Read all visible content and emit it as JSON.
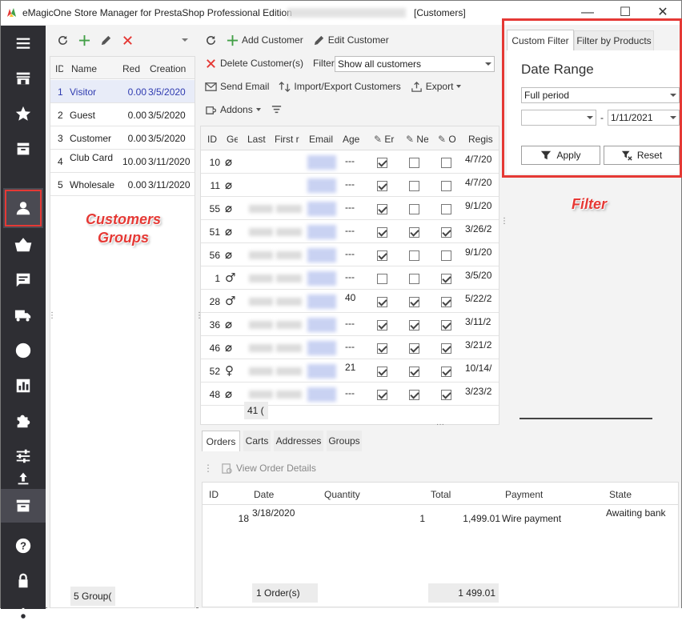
{
  "window": {
    "title": "eMagicOne Store Manager for PrestaShop Professional Edition",
    "document": "[Customers]",
    "controls": [
      "—",
      "☐",
      "✕"
    ]
  },
  "sidebar": {
    "icons": [
      "menu-icon",
      "store-icon",
      "star-icon",
      "catalog-box-icon",
      "customer-icon",
      "basket-icon",
      "message-icon",
      "truck-icon",
      "globe-icon",
      "report-icon",
      "puzzle-icon",
      "sliders-icon",
      "upload-icon",
      "archive-icon",
      "help-icon",
      "lock-icon",
      "settings-icon"
    ]
  },
  "groups": {
    "columns": [
      "ID",
      "Name",
      "Red",
      "Creation"
    ],
    "rows": [
      {
        "id": "1",
        "name": "Visitor",
        "red": "0.00",
        "date": "3/5/2020",
        "selected": true
      },
      {
        "id": "2",
        "name": "Guest",
        "red": "0.00",
        "date": "3/5/2020"
      },
      {
        "id": "3",
        "name": "Customer",
        "red": "0.00",
        "date": "3/5/2020"
      },
      {
        "id": "4",
        "name": "Club Card",
        "red": "10.00",
        "date": "3/11/2020"
      },
      {
        "id": "5",
        "name": "Wholesale",
        "red": "0.00",
        "date": "3/11/2020"
      }
    ],
    "footer": "5 Group("
  },
  "customers_toolbar": {
    "add": "Add Customer",
    "edit": "Edit Customer",
    "delete": "Delete Customer(s)",
    "filter_label": "Filter",
    "filter_value": "Show all customers",
    "send_email": "Send Email",
    "import_export": "Import/Export Customers",
    "export": "Export",
    "addons": "Addons"
  },
  "customers": {
    "columns": [
      "ID",
      "Ge",
      "Last",
      "First r",
      "Email",
      "Age",
      "Er",
      "Ne",
      "O",
      "Regis"
    ],
    "rows": [
      {
        "id": "10",
        "gender": "⌀",
        "age": "---",
        "c1": true,
        "c2": false,
        "c3": false,
        "reg": "4/7/20"
      },
      {
        "id": "11",
        "gender": "⌀",
        "age": "---",
        "c1": true,
        "c2": false,
        "c3": false,
        "reg": "4/7/20"
      },
      {
        "id": "55",
        "gender": "⌀",
        "age": "---",
        "c1": true,
        "c2": false,
        "c3": false,
        "reg": "9/1/20"
      },
      {
        "id": "51",
        "gender": "⌀",
        "age": "---",
        "c1": true,
        "c2": true,
        "c3": true,
        "reg": "3/26/2"
      },
      {
        "id": "56",
        "gender": "⌀",
        "age": "---",
        "c1": true,
        "c2": false,
        "c3": false,
        "reg": "9/1/20"
      },
      {
        "id": "1",
        "gender": "♂",
        "age": "---",
        "c1": false,
        "c2": false,
        "c3": true,
        "reg": "3/5/20"
      },
      {
        "id": "28",
        "gender": "♂",
        "age": "40",
        "c1": true,
        "c2": true,
        "c3": true,
        "reg": "5/22/2"
      },
      {
        "id": "36",
        "gender": "⌀",
        "age": "---",
        "c1": true,
        "c2": true,
        "c3": true,
        "reg": "3/11/2"
      },
      {
        "id": "46",
        "gender": "⌀",
        "age": "---",
        "c1": true,
        "c2": true,
        "c3": true,
        "reg": "3/21/2"
      },
      {
        "id": "52",
        "gender": "♀",
        "age": "21",
        "c1": true,
        "c2": true,
        "c3": true,
        "reg": "10/14/"
      },
      {
        "id": "48",
        "gender": "⌀",
        "age": "---",
        "c1": true,
        "c2": true,
        "c3": true,
        "reg": "3/23/2"
      }
    ],
    "footer": "41 ("
  },
  "detail_tabs": [
    "Orders",
    "Carts",
    "Addresses",
    "Groups"
  ],
  "orders": {
    "view_details": "View Order Details",
    "columns": [
      "ID",
      "Date",
      "Quantity",
      "Total",
      "Payment",
      "State"
    ],
    "rows": [
      {
        "id": "18",
        "date": "3/18/2020",
        "quantity": "1",
        "total": "1,499.01",
        "payment": "Wire payment",
        "state": "Awaiting bank"
      }
    ],
    "footer_count": "1 Order(s)",
    "footer_total": "1 499.01"
  },
  "filter_panel": {
    "tabs": [
      "Custom Filter",
      "Filter by Products"
    ],
    "heading": "Date Range",
    "period": "Full period",
    "date_from": "",
    "date_sep": "-",
    "date_to": "1/11/2021",
    "apply": "Apply",
    "reset": "Reset"
  },
  "annotations": {
    "groups_label": "Customers\nGroups",
    "filter_label": "Filter"
  },
  "colors": {
    "accent_red": "#e53935",
    "sidebar": "#2e2e33",
    "link_blue": "#2f3bb0"
  }
}
